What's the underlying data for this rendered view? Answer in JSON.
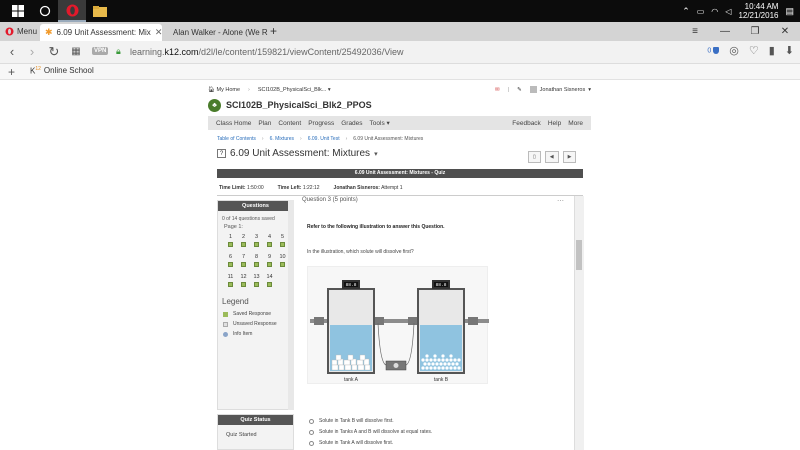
{
  "taskbar": {
    "time": "10:44 AM",
    "date": "12/21/2016"
  },
  "browser": {
    "menu_label": "Menu",
    "tabs": [
      {
        "title": "6.09 Unit Assessment: Mix"
      },
      {
        "title": "Alan Walker - Alone (We R"
      }
    ],
    "vpn_label": "VPN",
    "url_prefix": "learning.",
    "url_domain": "k12.com",
    "url_path": "/d2l/le/content/159821/viewContent/25492036/View",
    "badge_count": "0",
    "bookmark_label": "Online School",
    "bookmark_prefix": "K",
    "bookmark_sup": "12"
  },
  "k12_top": {
    "my_home": "My Home",
    "course_short": "SCI102B_PhysicalSci_Blk...",
    "user": "Jonathan Sisneros"
  },
  "course": {
    "title": "SCI102B_PhysicalSci_Blk2_PPOS"
  },
  "nav": {
    "left": [
      "Class Home",
      "Plan",
      "Content",
      "Progress",
      "Grades",
      "Tools ▾"
    ],
    "right": [
      "Feedback",
      "Help",
      "More"
    ]
  },
  "breadcrumbs": [
    "Table of Contents",
    "6. Mixtures",
    "6.09. Unit Test",
    "6.09 Unit Assessment: Mixtures"
  ],
  "page_title": "6.09 Unit Assessment: Mixtures",
  "quiz_bar": "6.09 Unit Assessment: Mixtures - Quiz",
  "timer": {
    "limit_label": "Time Limit:",
    "limit_value": "1:50:00",
    "left_label": "Time Left:",
    "left_value": "1:22:12",
    "user": "Jonathan Sisneros:",
    "attempt": "Attempt 1"
  },
  "sidebar": {
    "header": "Questions",
    "saved": "0 of 14 questions saved",
    "page": "Page 1:",
    "questions": [
      "1",
      "2",
      "3",
      "4",
      "5",
      "6",
      "7",
      "8",
      "9",
      "10",
      "11",
      "12",
      "13",
      "14"
    ],
    "legend_title": "Legend",
    "legend": [
      {
        "label": "Saved Response",
        "color": "#9bbb5a"
      },
      {
        "label": "Unsaved Response",
        "color": "#e0e0e0"
      },
      {
        "label": "Info Item",
        "color": "#8aa4c8"
      }
    ],
    "status_header": "Quiz Status",
    "status_text": "Quiz Started"
  },
  "question": {
    "header": "Question 3 (5 points)",
    "instruction": "Refer to the following illustration to answer this Question.",
    "prompt": "In the illustration, which solute will dissolve first?",
    "tank_a": "tank A",
    "tank_b": "tank B",
    "gauge_a": "88.8",
    "gauge_b": "88.8",
    "options": [
      "Solute in Tank B will dissolve first.",
      "Solute in Tanks A and B will dissolve at equal rates.",
      "Solute in Tank A will dissolve first."
    ]
  }
}
